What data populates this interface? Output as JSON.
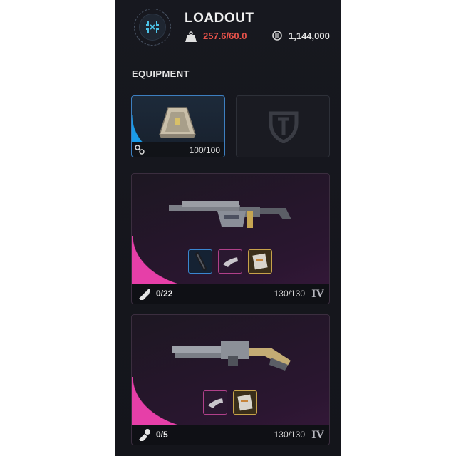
{
  "header": {
    "title": "LOADOUT",
    "weight": "257.6/60.0",
    "currency": "1,144,000",
    "emblem_icon": "loadout-emblem-icon",
    "weight_icon": "weight-icon",
    "currency_icon": "coin-icon"
  },
  "equipment": {
    "section_label": "EQUIPMENT",
    "shield": {
      "durability": "100/100",
      "rarity_color": "#1a9be8"
    },
    "empty_slot": {
      "icon": "shield-emblem-icon"
    }
  },
  "weapons": [
    {
      "ammo": "0/22",
      "durability": "130/130",
      "tier": "IV",
      "rarity_color": "#e63fa8",
      "mods": [
        "silencer-mod",
        "grip-mod",
        "magazine-mod"
      ]
    },
    {
      "ammo": "0/5",
      "durability": "130/130",
      "tier": "IV",
      "rarity_color": "#e63fa8",
      "mods": [
        "grip-mod",
        "magazine-mod"
      ]
    }
  ],
  "colors": {
    "panel": "#15161d",
    "weight_warning": "#e8524a"
  }
}
